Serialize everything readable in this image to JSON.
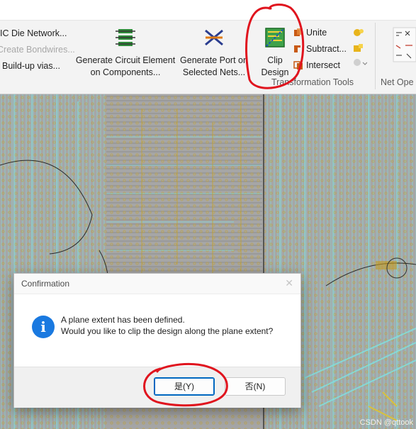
{
  "ribbon": {
    "left_items": [
      "IC Die Network...",
      "Create Bondwires...",
      "Build-up vias..."
    ],
    "generate_circuit": [
      "Generate Circuit Element",
      "on Components..."
    ],
    "generate_port": [
      "Generate Port on",
      "Selected Nets..."
    ],
    "clip_design": [
      "Clip",
      "Design"
    ],
    "tools": [
      "Unite",
      "Subtract...",
      "Intersect"
    ],
    "group_label": "Transformation Tools",
    "net_group_label": "Net Ope"
  },
  "dialog": {
    "title": "Confirmation",
    "close": "✕",
    "line1": "A plane extent has been defined.",
    "line2": "Would you like to clip the design along the plane extent?",
    "info_glyph": "i",
    "yes_label": "是(Y)",
    "no_label": "否(N)"
  },
  "watermark": "CSDN @qttook",
  "colors": {
    "accent": "#0067c0",
    "info": "#1a79e0",
    "annotation": "#e0141e",
    "trace_cyan": "#7fe3e3",
    "trace_gold": "#c9a21c"
  }
}
